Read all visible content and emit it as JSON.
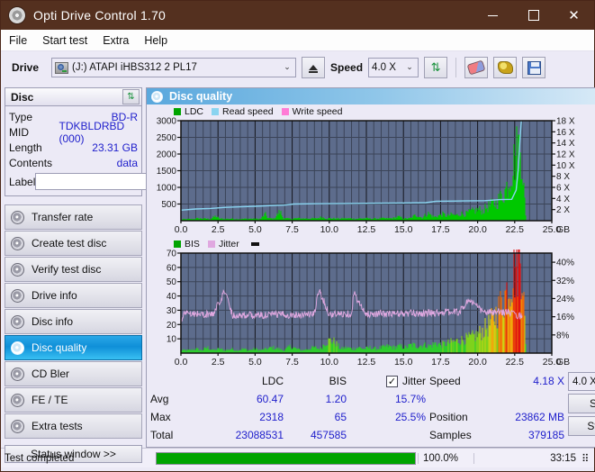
{
  "window": {
    "title": "Opti Drive Control 1.70",
    "app_icon": "disc-icon",
    "minimize": "minimize-icon",
    "maximize": "maximize-icon",
    "close": "close-icon",
    "titlebar_color": "#54301f"
  },
  "menu": {
    "items": [
      "File",
      "Start test",
      "Extra",
      "Help"
    ]
  },
  "toolbar": {
    "drive_label": "Drive",
    "drive_value": "(J:)   ATAPI iHBS312   2 PL17",
    "eject_icon": "eject-icon",
    "speed_label": "Speed",
    "speed_value": "4.0 X",
    "refresh_icon": "refresh-icon",
    "eraser_icon": "eraser-icon",
    "gold_icon": "bitsetting-icon",
    "save_icon": "save-icon"
  },
  "disc_panel": {
    "header": "Disc",
    "refresh_icon": "refresh-icon",
    "rows": [
      {
        "key": "Type",
        "value": "BD-R"
      },
      {
        "key": "MID",
        "value": "TDKBLDRBD (000)"
      },
      {
        "key": "Length",
        "value": "23.31 GB"
      },
      {
        "key": "Contents",
        "value": "data"
      }
    ],
    "label_key": "Label",
    "label_value": "",
    "label_placeholder": "",
    "disc_button_icon": "cd-icon"
  },
  "sidebar": {
    "items": [
      {
        "label": "Transfer rate",
        "icon": "disc-icon",
        "active": false
      },
      {
        "label": "Create test disc",
        "icon": "disc-icon",
        "active": false
      },
      {
        "label": "Verify test disc",
        "icon": "disc-icon",
        "active": false
      },
      {
        "label": "Drive info",
        "icon": "disc-icon",
        "active": false
      },
      {
        "label": "Disc info",
        "icon": "disc-icon",
        "active": false
      },
      {
        "label": "Disc quality",
        "icon": "disc-icon",
        "active": true
      },
      {
        "label": "CD Bler",
        "icon": "disc-icon",
        "active": false
      },
      {
        "label": "FE / TE",
        "icon": "disc-icon",
        "active": false
      },
      {
        "label": "Extra tests",
        "icon": "disc-icon",
        "active": false
      }
    ],
    "status_window_button": "Status window >>"
  },
  "main": {
    "panel_title": "Disc quality",
    "panel_icon": "disc-icon"
  },
  "stats": {
    "col_headers": [
      "",
      "LDC",
      "BIS",
      "Jitter"
    ],
    "jitter_checkbox_checked": true,
    "jitter_label": "Jitter",
    "jitter_check_glyph": "✓",
    "rows": [
      {
        "label": "Avg",
        "ldc": "60.47",
        "bis": "1.20",
        "jitter": "15.7%"
      },
      {
        "label": "Max",
        "ldc": "2318",
        "bis": "65",
        "jitter": "25.5%"
      },
      {
        "label": "Total",
        "ldc": "23088531",
        "bis": "457585",
        "jitter": ""
      }
    ],
    "speed_key": "Speed",
    "speed_value": "4.18 X",
    "position_key": "Position",
    "position_value": "23862 MB",
    "samples_key": "Samples",
    "samples_value": "379185",
    "speed_select": "4.0 X",
    "start_full": "Start full",
    "start_part": "Start part"
  },
  "statusbar": {
    "text": "Test completed",
    "percent_label": "100.0%",
    "percent_value": 100,
    "elapsed": "33:15",
    "progress_color": "#00a400"
  },
  "chart_data": [
    {
      "type": "area",
      "id": "ldc-chart",
      "title": "",
      "xlabel": "GB",
      "ylabel": "",
      "grid": true,
      "legend_position": "top-left",
      "legend": [
        {
          "label": "LDC",
          "color": "#00a400"
        },
        {
          "label": "Read speed",
          "color": "#8ad4f0"
        },
        {
          "label": "Write speed",
          "color": "#ff7bd6"
        }
      ],
      "plot_bg": "#5d6c8c",
      "xlim": [
        0,
        25.0
      ],
      "xticks": [
        0.0,
        2.5,
        5.0,
        7.5,
        10.0,
        12.5,
        15.0,
        17.5,
        20.0,
        22.5,
        25.0
      ],
      "xtick_labels": [
        "0.0",
        "2.5",
        "5.0",
        "7.5",
        "10.0",
        "12.5",
        "15.0",
        "17.5",
        "20.0",
        "22.5",
        "25.0"
      ],
      "x_unit": "GB",
      "ylim": [
        0,
        3000
      ],
      "yticks": [
        500,
        1000,
        1500,
        2000,
        2500,
        3000
      ],
      "ytick_labels": [
        "500",
        "1000",
        "1500",
        "2000",
        "2500",
        "3000"
      ],
      "y2lim": [
        0,
        18
      ],
      "y2ticks": [
        2,
        4,
        6,
        8,
        10,
        12,
        14,
        16,
        18
      ],
      "y2tick_labels": [
        "2 X",
        "4 X",
        "6 X",
        "8 X",
        "10 X",
        "12 X",
        "14 X",
        "16 X",
        "18 X"
      ],
      "series": [
        {
          "name": "LDC",
          "color": "#00c800",
          "kind": "spike-area",
          "axis": "left",
          "x": [
            0.1,
            0.4,
            0.8,
            1.2,
            1.6,
            2.0,
            2.35,
            2.6,
            3.0,
            3.4,
            3.8,
            4.2,
            4.6,
            5.0,
            5.4,
            5.7,
            5.9,
            6.3,
            6.7,
            6.9,
            7.1,
            7.5,
            7.9,
            8.3,
            8.7,
            9.1,
            9.5,
            9.9,
            10.3,
            10.7,
            11.1,
            11.5,
            11.9,
            12.3,
            12.7,
            13.1,
            13.5,
            13.9,
            14.3,
            14.7,
            15.1,
            15.5,
            15.9,
            16.3,
            16.7,
            17.1,
            17.4,
            17.7,
            18.0,
            18.3,
            18.6,
            18.9,
            19.2,
            19.5,
            19.8,
            20.1,
            20.4,
            20.7,
            21.0,
            21.3,
            21.6,
            21.9,
            22.1,
            22.3,
            22.5,
            22.7,
            22.9,
            23.0,
            23.1,
            23.2,
            23.3
          ],
          "y": [
            40,
            45,
            50,
            70,
            60,
            55,
            140,
            60,
            55,
            60,
            55,
            50,
            60,
            55,
            55,
            200,
            70,
            60,
            290,
            90,
            60,
            60,
            70,
            65,
            70,
            60,
            110,
            65,
            70,
            60,
            70,
            65,
            60,
            70,
            65,
            60,
            70,
            65,
            70,
            120,
            65,
            70,
            180,
            90,
            230,
            110,
            150,
            200,
            140,
            190,
            160,
            220,
            200,
            260,
            300,
            340,
            300,
            420,
            480,
            560,
            700,
            900,
            1150,
            1450,
            1800,
            2150,
            2318,
            2200,
            1600,
            800,
            120
          ]
        },
        {
          "name": "Read speed",
          "color": "#8ad4f0",
          "kind": "line",
          "axis": "right",
          "x": [
            0.0,
            1.0,
            2.0,
            3.0,
            4.0,
            5.0,
            6.0,
            7.0,
            7.6,
            9.0,
            11.0,
            13.0,
            15.0,
            16.5,
            17.2,
            19.0,
            20.5,
            21.5,
            22.3,
            22.6,
            22.75,
            22.85,
            22.95
          ],
          "y": [
            1.9,
            2.1,
            2.2,
            2.4,
            2.5,
            2.6,
            2.7,
            2.8,
            3.0,
            3.05,
            3.1,
            3.15,
            3.2,
            3.25,
            3.5,
            3.55,
            3.6,
            3.8,
            3.85,
            5.5,
            9.5,
            14.5,
            18.0
          ]
        }
      ]
    },
    {
      "type": "area",
      "id": "bis-jitter-chart",
      "title": "",
      "xlabel": "GB",
      "grid": true,
      "legend_position": "top-left",
      "legend": [
        {
          "label": "BIS",
          "color": "#00a400"
        },
        {
          "label": "Jitter",
          "color": "#e0a8e0"
        }
      ],
      "plot_bg": "#5d6c8c",
      "xlim": [
        0,
        25.0
      ],
      "xticks": [
        0.0,
        2.5,
        5.0,
        7.5,
        10.0,
        12.5,
        15.0,
        17.5,
        20.0,
        22.5,
        25.0
      ],
      "xtick_labels": [
        "0.0",
        "2.5",
        "5.0",
        "7.5",
        "10.0",
        "12.5",
        "15.0",
        "17.5",
        "20.0",
        "22.5",
        "25.0"
      ],
      "x_unit": "GB",
      "ylim": [
        0,
        70
      ],
      "yticks": [
        10,
        20,
        30,
        40,
        50,
        60,
        70
      ],
      "ytick_labels": [
        "10",
        "20",
        "30",
        "40",
        "50",
        "60",
        "70"
      ],
      "y2lim": [
        0,
        44
      ],
      "y2ticks": [
        8,
        16,
        24,
        32,
        40
      ],
      "y2tick_labels": [
        "8%",
        "16%",
        "24%",
        "32%",
        "40%"
      ],
      "series": [
        {
          "name": "BIS",
          "color": "#2ecc2e",
          "kind": "spike-area-gradient",
          "axis": "left",
          "x": [
            0.2,
            0.6,
            1.0,
            1.4,
            1.8,
            2.2,
            2.6,
            3.0,
            3.4,
            3.8,
            4.2,
            4.6,
            5.0,
            5.4,
            5.8,
            6.2,
            6.6,
            7.0,
            7.4,
            7.8,
            8.2,
            8.6,
            9.0,
            9.4,
            9.8,
            10.1,
            10.4,
            10.8,
            11.2,
            11.6,
            12.0,
            12.4,
            12.8,
            13.2,
            13.6,
            14.0,
            14.4,
            14.8,
            15.2,
            15.6,
            16.0,
            16.4,
            16.8,
            17.2,
            17.6,
            18.0,
            18.4,
            18.8,
            19.2,
            19.6,
            20.0,
            20.4,
            20.8,
            21.2,
            21.6,
            22.0,
            22.2,
            22.4,
            22.6,
            22.8,
            22.95,
            23.1,
            23.2,
            23.3
          ],
          "y": [
            2,
            2,
            3,
            2,
            4,
            2,
            3,
            2,
            3,
            2,
            3,
            2,
            3,
            2,
            3,
            4,
            3,
            2,
            5,
            3,
            2,
            3,
            4,
            3,
            8,
            9,
            8,
            3,
            4,
            3,
            4,
            3,
            4,
            3,
            4,
            5,
            4,
            5,
            4,
            6,
            5,
            6,
            5,
            7,
            6,
            7,
            8,
            9,
            10,
            11,
            13,
            16,
            20,
            26,
            34,
            44,
            50,
            56,
            62,
            68,
            70,
            60,
            30,
            5
          ]
        },
        {
          "name": "Jitter",
          "color": "#e0a8e0",
          "kind": "noise-line",
          "axis": "right",
          "avg": 15.7,
          "max": 25.5,
          "x": [
            0.0,
            0.3,
            0.8,
            1.5,
            2.2,
            2.95,
            3.5,
            4.2,
            5.0,
            5.8,
            6.6,
            7.4,
            8.2,
            9.0,
            9.3,
            10.0,
            10.8,
            11.5,
            11.65,
            12.4,
            13.2,
            14.0,
            14.8,
            15.6,
            16.4,
            17.2,
            18.0,
            18.8,
            19.4,
            19.7,
            20.4,
            21.0,
            21.6,
            22.0,
            22.4,
            22.8,
            23.0
          ],
          "y": [
            13.5,
            18.5,
            17.5,
            17.0,
            17.2,
            27.5,
            16.5,
            16.8,
            16.5,
            16.8,
            17.0,
            16.8,
            17.0,
            17.2,
            28.0,
            17.0,
            17.2,
            17.4,
            26.5,
            17.2,
            17.4,
            17.2,
            17.4,
            17.5,
            17.6,
            17.8,
            18.0,
            18.2,
            23.5,
            22.0,
            18.0,
            17.8,
            18.0,
            18.2,
            17.0,
            16.5,
            16.0
          ]
        }
      ]
    }
  ]
}
